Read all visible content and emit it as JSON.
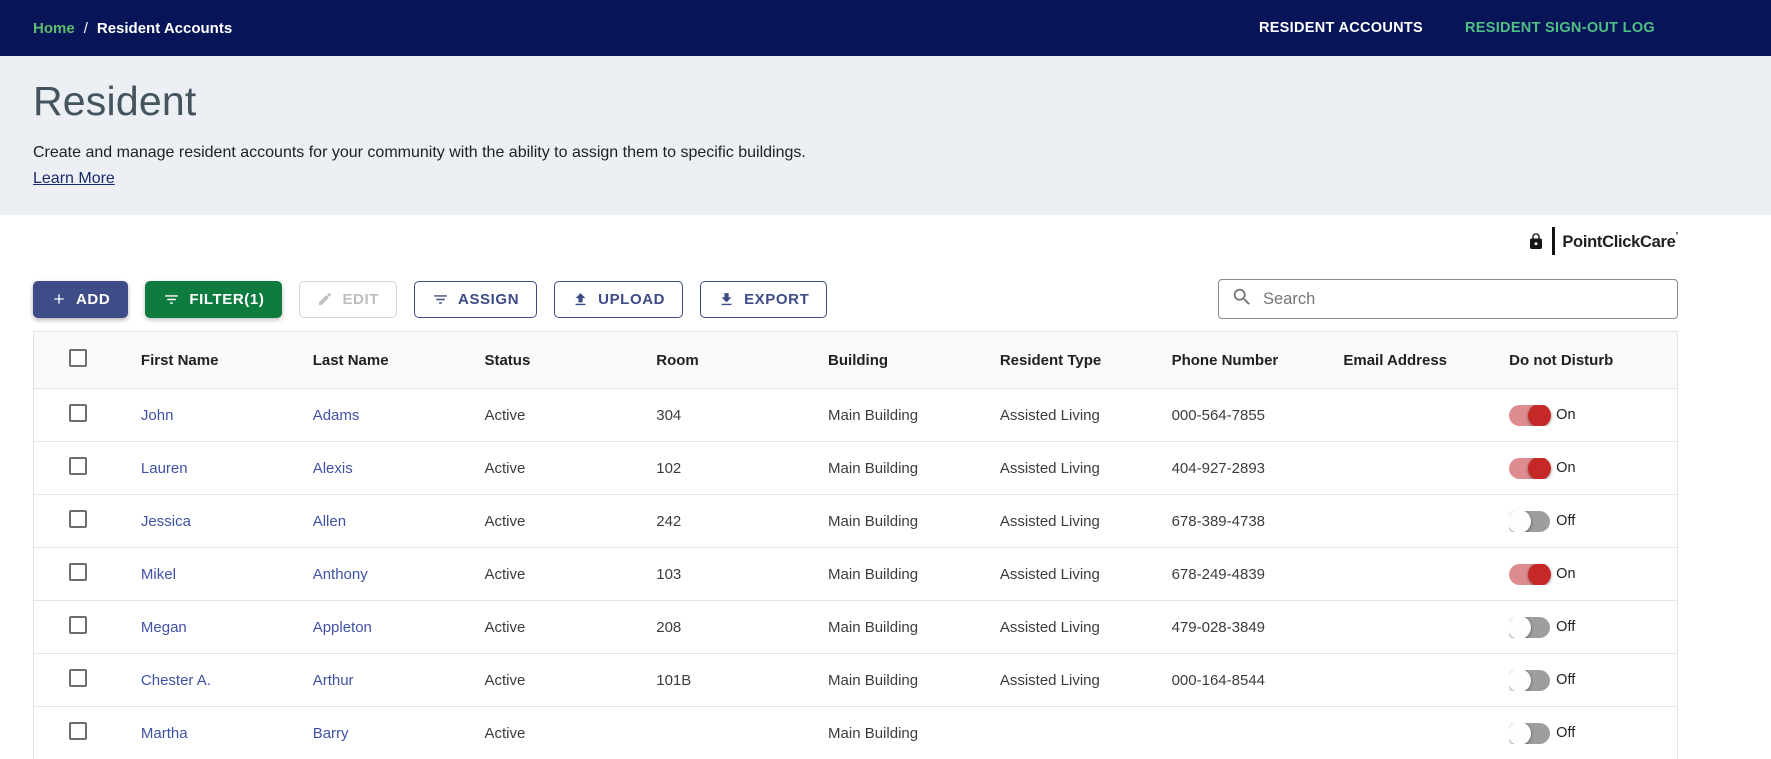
{
  "navbar": {
    "breadcrumb": {
      "home": "Home",
      "separator": "/",
      "current": "Resident Accounts"
    },
    "links": [
      {
        "label": "RESIDENT ACCOUNTS",
        "active": true
      },
      {
        "label": "RESIDENT SIGN-OUT LOG",
        "active": false
      }
    ]
  },
  "hero": {
    "title": "Resident",
    "description": "Create and manage resident accounts for your community with the ability to assign them to specific buildings.",
    "learn_more": "Learn More"
  },
  "brand": {
    "icon": "lock-icon",
    "name": "PointClickCare",
    "mark": "’"
  },
  "toolbar": {
    "add_label": "ADD",
    "filter_label": "FILTER(1)",
    "edit_label": "EDIT",
    "assign_label": "ASSIGN",
    "upload_label": "UPLOAD",
    "export_label": "EXPORT",
    "search_placeholder": "Search"
  },
  "table": {
    "columns": [
      "First Name",
      "Last Name",
      "Status",
      "Room",
      "Building",
      "Resident Type",
      "Phone Number",
      "Email Address",
      "Do not Disturb"
    ],
    "rows": [
      {
        "first_name": "John",
        "last_name": "Adams",
        "status": "Active",
        "room": "304",
        "building": "Main Building",
        "resident_type": "Assisted Living",
        "phone": "000-564-7855",
        "email": "",
        "dnd": "On"
      },
      {
        "first_name": "Lauren",
        "last_name": "Alexis",
        "status": "Active",
        "room": "102",
        "building": "Main Building",
        "resident_type": "Assisted Living",
        "phone": "404-927-2893",
        "email": "",
        "dnd": "On"
      },
      {
        "first_name": "Jessica",
        "last_name": "Allen",
        "status": "Active",
        "room": "242",
        "building": "Main Building",
        "resident_type": "Assisted Living",
        "phone": "678-389-4738",
        "email": "",
        "dnd": "Off"
      },
      {
        "first_name": "Mikel",
        "last_name": "Anthony",
        "status": "Active",
        "room": "103",
        "building": "Main Building",
        "resident_type": "Assisted Living",
        "phone": "678-249-4839",
        "email": "",
        "dnd": "On"
      },
      {
        "first_name": "Megan",
        "last_name": "Appleton",
        "status": "Active",
        "room": "208",
        "building": "Main Building",
        "resident_type": "Assisted Living",
        "phone": "479-028-3849",
        "email": "",
        "dnd": "Off"
      },
      {
        "first_name": "Chester A.",
        "last_name": "Arthur",
        "status": "Active",
        "room": "101B",
        "building": "Main Building",
        "resident_type": "Assisted Living",
        "phone": "000-164-8544",
        "email": "",
        "dnd": "Off"
      },
      {
        "first_name": "Martha",
        "last_name": "Barry",
        "status": "Active",
        "room": "",
        "building": "Main Building",
        "resident_type": "",
        "phone": "",
        "email": "",
        "dnd": "Off"
      }
    ]
  },
  "colors": {
    "navbar_bg": "#071457",
    "breadcrumb_home_green": "#5FBC6F",
    "nav_link_green": "#4FC085",
    "hero_bg": "#ECEFF3",
    "hero_title": "#44545E",
    "button_navy": "#3E4C87",
    "button_green": "#0E7C3F",
    "row_link": "#3F51A5",
    "toggle_on_knob": "#C62828",
    "toggle_on_track": "#DE8C90",
    "toggle_off_knob": "#FEFEFE",
    "toggle_off_track": "#9E9E9E"
  }
}
